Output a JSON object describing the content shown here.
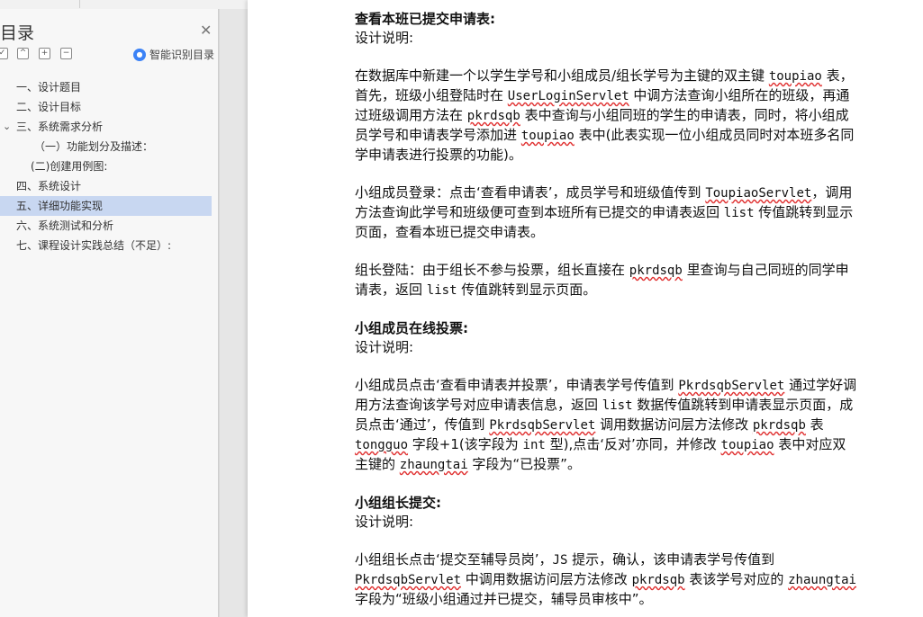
{
  "sidebar": {
    "title": "目录",
    "smart_toc_label": "智能识别目录",
    "toc": [
      {
        "label": "一、设计题目",
        "level": 1,
        "expanded": false,
        "active": false
      },
      {
        "label": "二、设计目标",
        "level": 1,
        "expanded": false,
        "active": false
      },
      {
        "label": "三、系统需求分析",
        "level": 1,
        "expanded": true,
        "active": false
      },
      {
        "label": "（一）功能划分及描述：",
        "level": 2,
        "expanded": false,
        "active": false
      },
      {
        "label": "(二)创建用例图:",
        "level": 2,
        "expanded": false,
        "active": false
      },
      {
        "label": "四、系统设计",
        "level": 1,
        "expanded": false,
        "active": false
      },
      {
        "label": "五、详细功能实现",
        "level": 1,
        "expanded": false,
        "active": true
      },
      {
        "label": "六、系统测试和分析",
        "level": 1,
        "expanded": false,
        "active": false
      },
      {
        "label": "七、课程设计实践总结（不足）:",
        "level": 1,
        "expanded": false,
        "active": false
      }
    ]
  },
  "doc": {
    "s1": {
      "heading": "查看本班已提交申请表:",
      "note": "设计说明:",
      "p1": [
        {
          "t": "在数据库中新建一个以学生学号和小组成员/组长学号为主键的双主键 "
        },
        {
          "t": "toupiao",
          "c": 1
        },
        {
          "t": " 表，首先，班级小组登陆时在 "
        },
        {
          "t": "UserLoginServlet",
          "c": 1
        },
        {
          "t": " 中调方法查询小组所在的班级，再通过班级调用方法在 "
        },
        {
          "t": "pkrdsqb",
          "c": 1
        },
        {
          "t": " 表中查询与小组同班的学生的申请表，同时，将小组成员学号和申请表学号添加进 "
        },
        {
          "t": "toupiao",
          "c": 1
        },
        {
          "t": " 表中(此表实现一位小组成员同时对本班多名同学申请表进行投票的功能)。"
        }
      ],
      "p2": [
        {
          "t": "小组成员登录：点击‘查看申请表’，成员学号和班级值传到 "
        },
        {
          "t": "ToupiaoServlet",
          "c": 1
        },
        {
          "t": "，调用方法查询此学号和班级便可查到本班所有已提交的申请表返回 "
        },
        {
          "t": "list",
          "c": 2
        },
        {
          "t": " 传值跳转到显示页面，查看本班已提交申请表。"
        }
      ],
      "p3": [
        {
          "t": "组长登陆：由于组长不参与投票，组长直接在 "
        },
        {
          "t": "pkrdsqb",
          "c": 1
        },
        {
          "t": " 里查询与自己同班的同学申请表，返回 "
        },
        {
          "t": "list",
          "c": 2
        },
        {
          "t": " 传值跳转到显示页面。"
        }
      ]
    },
    "s2": {
      "heading": "小组成员在线投票:",
      "note": "设计说明:",
      "p1": [
        {
          "t": "小组成员点击‘查看申请表并投票’，申请表学号传值到 "
        },
        {
          "t": "PkrdsqbServlet",
          "c": 1
        },
        {
          "t": " 通过学好调用方法查询该学号对应申请表信息，返回 "
        },
        {
          "t": "list",
          "c": 2
        },
        {
          "t": " 数据传值跳转到申请表显示页面，成员点击‘通过’，传值到 "
        },
        {
          "t": "PkrdsqbServlet",
          "c": 1
        },
        {
          "t": " 调用数据访问层方法修改 "
        },
        {
          "t": "pkrdsqb",
          "c": 1
        },
        {
          "t": " 表 "
        },
        {
          "t": "tongguo",
          "c": 1
        },
        {
          "t": " 字段+1(该字段为 "
        },
        {
          "t": "int",
          "c": 2
        },
        {
          "t": " 型),点击‘反对’亦同，并修改 "
        },
        {
          "t": "toupiao",
          "c": 1
        },
        {
          "t": " 表中对应双主键的 "
        },
        {
          "t": "zhaungtai",
          "c": 1
        },
        {
          "t": " 字段为“已投票”。"
        }
      ]
    },
    "s3": {
      "heading": "小组组长提交:",
      "note": "设计说明:",
      "p1": [
        {
          "t": "小组组长点击‘提交至辅导员岗’，"
        },
        {
          "t": "JS",
          "c": 2
        },
        {
          "t": " 提示，确认，该申请表学号传值到 "
        },
        {
          "t": "PkrdsqbServlet",
          "c": 1
        },
        {
          "t": " 中调用数据访问层方法修改 "
        },
        {
          "t": "pkrdsqb",
          "c": 1
        },
        {
          "t": " 表该学号对应的 "
        },
        {
          "t": "zhaungtai",
          "c": 1
        },
        {
          "t": " 字段为“班级小组通过并已提交，辅导员审核中”。"
        }
      ]
    }
  }
}
